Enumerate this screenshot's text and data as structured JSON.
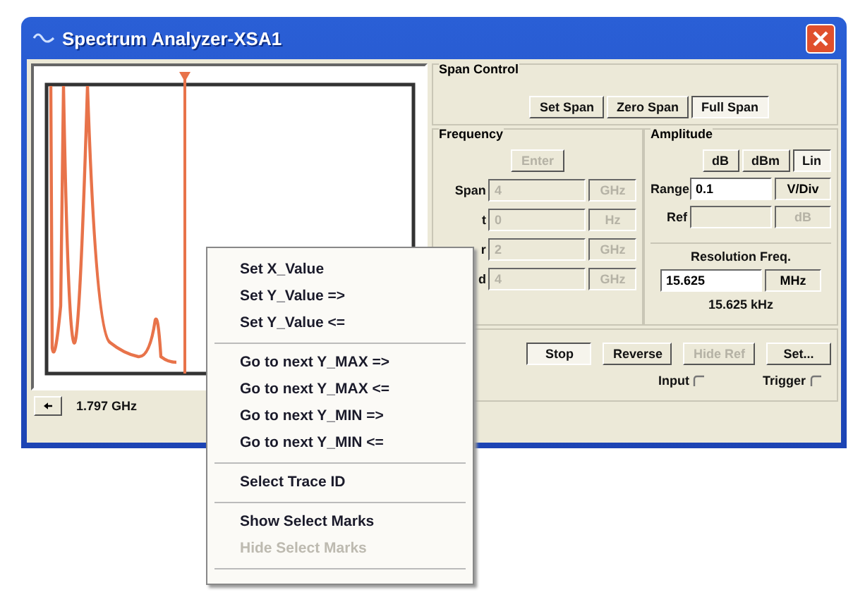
{
  "window": {
    "title": "Spectrum Analyzer-XSA1"
  },
  "plot": {
    "cursor_reading": "1.797 GHz"
  },
  "span_control": {
    "title": "Span Control",
    "buttons": [
      {
        "label": "Set Span",
        "selected": false
      },
      {
        "label": "Zero Span",
        "selected": false
      },
      {
        "label": "Full Span",
        "selected": true
      }
    ]
  },
  "frequency": {
    "title": "Frequency",
    "enter_button": {
      "label": "Enter",
      "disabled": true
    },
    "rows": [
      {
        "label": "Span",
        "value": "4",
        "unit": "GHz",
        "disabled": true
      },
      {
        "label": "t",
        "value": "0",
        "unit": "Hz",
        "disabled": true
      },
      {
        "label": "r",
        "value": "2",
        "unit": "GHz",
        "disabled": true
      },
      {
        "label": "d",
        "value": "4",
        "unit": "GHz",
        "disabled": true
      }
    ]
  },
  "amplitude": {
    "title": "Amplitude",
    "buttons": [
      {
        "label": "dB",
        "selected": false
      },
      {
        "label": "dBm",
        "selected": false
      },
      {
        "label": "Lin",
        "selected": true
      }
    ],
    "range": {
      "label": "Range",
      "value": "0.1",
      "unit": "V/Div",
      "disabled": false
    },
    "ref": {
      "label": "Ref",
      "unit": "dB",
      "disabled": true
    }
  },
  "resolution": {
    "title": "Resolution Freq.",
    "value": "15.625",
    "unit": "MHz",
    "reading": "15.625 kHz"
  },
  "controls": [
    {
      "label": "Stop",
      "selected": true,
      "disabled": false
    },
    {
      "label": "Reverse",
      "selected": false,
      "disabled": false
    },
    {
      "label": "Hide Ref",
      "selected": false,
      "disabled": true
    },
    {
      "label": "Set...",
      "selected": false,
      "disabled": false
    }
  ],
  "terminals": [
    {
      "label": "Input"
    },
    {
      "label": "Trigger"
    }
  ],
  "context_menu": [
    {
      "kind": "item",
      "label": "Set X_Value",
      "disabled": false
    },
    {
      "kind": "item",
      "label": "Set Y_Value =>",
      "disabled": false
    },
    {
      "kind": "item",
      "label": "Set Y_Value <=",
      "disabled": false
    },
    {
      "kind": "separator"
    },
    {
      "kind": "item",
      "label": "Go to next Y_MAX =>",
      "disabled": false
    },
    {
      "kind": "item",
      "label": "Go to next Y_MAX <=",
      "disabled": false
    },
    {
      "kind": "item",
      "label": "Go to next Y_MIN =>",
      "disabled": false
    },
    {
      "kind": "item",
      "label": "Go to next Y_MIN <=",
      "disabled": false
    },
    {
      "kind": "separator"
    },
    {
      "kind": "item",
      "label": "Select Trace ID",
      "disabled": false
    },
    {
      "kind": "separator"
    },
    {
      "kind": "item",
      "label": "Show Select Marks",
      "disabled": false
    },
    {
      "kind": "item",
      "label": "Hide Select Marks",
      "disabled": true
    },
    {
      "kind": "separator"
    }
  ]
}
